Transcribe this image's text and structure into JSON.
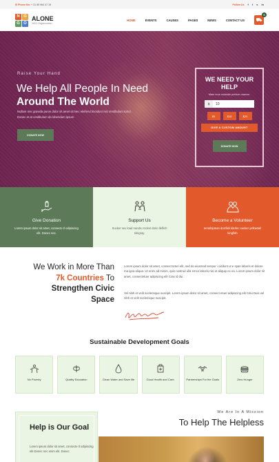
{
  "topbar": {
    "phone_label": "Phone No:",
    "phone_number": "+ 31 85 964 47 15",
    "follow_label": "Follow Us",
    "socials": [
      "facebook-icon",
      "twitter-icon",
      "skype-icon",
      "linkedin-icon"
    ]
  },
  "header": {
    "logo_letters": [
      "N",
      "G",
      "G",
      "O"
    ],
    "logo_colors": [
      "#e25a2b",
      "#f0a13a",
      "#5d9c5c",
      "#4a7bd0"
    ],
    "brand": "ALONE",
    "brand_sub": "NGO Organization",
    "nav": [
      "HOME",
      "EVENTS",
      "CAUSES",
      "PAGES",
      "NEWS",
      "CONTACT US"
    ],
    "active_nav": "HOME",
    "cart_count": "0"
  },
  "hero": {
    "eyebrow": "Raise Your Hand",
    "title_plain": "We Help All People In Need ",
    "title_bold": "Around The World",
    "description": "Nullam mer gravida purus dolor sit amet sit Nec eleifend tincidunt nisi Vestibulum tortor. Donec et at vestibulum da lobendum ipsum",
    "button": "DONATE NOW"
  },
  "donate_box": {
    "title": "WE NEED YOUR HELP",
    "subtitle": "Maer eros molestie pretium maecm.",
    "currency": "$",
    "amount": "10",
    "chips": [
      "$5",
      "$10",
      "$20"
    ],
    "custom_button": "GIVE A CUSTOM AMOUNT",
    "donate_button": "DONATE NOW"
  },
  "features": [
    {
      "icon": "donation-icon",
      "title": "Give Donation",
      "text": "Lorem ipsum dolor sit amet, consecte tl odipiscing elit. Donec nec."
    },
    {
      "icon": "support-icon",
      "title": "Support Us",
      "text": "Sucker sex load nandru rocket dorio lleflich stingray."
    },
    {
      "icon": "volunteer-icon",
      "title": "Become a Volunteer",
      "text": "Ieroshipman dorrfish lderlec sucker yellowtail kingfish"
    }
  ],
  "about": {
    "h_part1": "We Work in More Than ",
    "h_highlight": "7k Countries",
    "h_part2": " To ",
    "h_bold": "Strengthen Civic Space",
    "p1": "Lorem ipsum dolor sit amet, consect teturi elit, sed do eiusmod tempor i ciddunt ut e span laboris et dolore ma igna aliqua. Ut enim ad minim, quis nostrud ulla emco laboris nisi ut aliquip ex ea. Lorem ipsum dolor sit amet, consectetuer adipiscing elit Cras id dui.",
    "p2": "Vel nibh et velit scelerisque suscipit. Lorem ipsum dolor sit amet, consect etuer adipiscing elit Cdui Duis vel nibh et velit scelerisque suscipit."
  },
  "goals": {
    "title": "Sustainable Development Goals",
    "items": [
      {
        "icon": "poverty-icon",
        "label": "No Poverty"
      },
      {
        "icon": "education-icon",
        "label": "Quality Education"
      },
      {
        "icon": "water-icon",
        "label": "Clean Water and Save life"
      },
      {
        "icon": "health-icon",
        "label": "Good Health and Care."
      },
      {
        "icon": "partnership-icon",
        "label": "Partnerships For the Goals"
      },
      {
        "icon": "hunger-icon",
        "label": "Zero Hunger"
      }
    ]
  },
  "mission": {
    "eyebrow": "We Are In A Mission",
    "title": "To Help The Helpless",
    "card_title": "Help is Our Goal",
    "card_text": "Lorem ipsum dolor sit amet, consecte tl odipiscing elit Donec nec enim elit. Donec"
  }
}
